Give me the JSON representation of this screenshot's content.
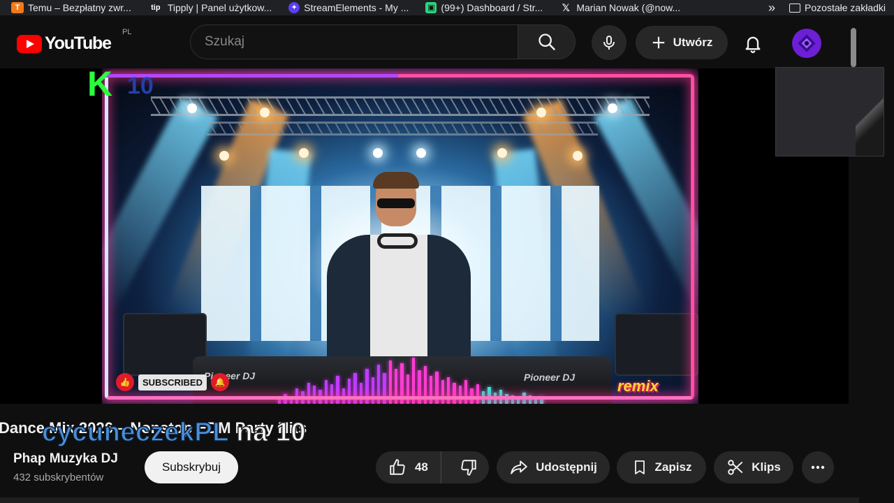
{
  "bookmarks": [
    {
      "label": "Temu – Bezpłatny zwr...",
      "icon": "temu-icon",
      "color": "#f27a1a"
    },
    {
      "label": "Tipply | Panel użytkow...",
      "icon": "tipply-icon",
      "color": "#ffffff"
    },
    {
      "label": "StreamElements - My ...",
      "icon": "streamelements-icon",
      "color": "#5a3ff5"
    },
    {
      "label": "(99+) Dashboard / Str...",
      "icon": "twitch-icon",
      "color": "#2bd67b"
    },
    {
      "label": "Marian Nowak (@now...",
      "icon": "x-icon",
      "color": "#ffffff"
    }
  ],
  "bookmarks_more": "»",
  "other_bookmarks": "Pozostałe zakładki",
  "header": {
    "logo_text": "YouTube",
    "country_code": "PL",
    "search_placeholder": "Szukaj",
    "create_label": "Utwórz"
  },
  "video": {
    "logo_k": "K",
    "logo_10": "10",
    "subscribed_label": "SUBSCRIBED",
    "deck_brand_left": "Pioneer DJ",
    "deck_brand_right": "Pioneer DJ",
    "remix_label": "remix"
  },
  "info": {
    "title": "Dance Mix 2026 – Nonstop EDM Party Hits",
    "overlay_name": "cycuneczekPL",
    "overlay_suffix": "na 10",
    "channel_name": "Phap Muzyka DJ",
    "subscribers": "432 subskrybentów",
    "subscribe_label": "Subskrybuj",
    "like_count": "48",
    "share_label": "Udostępnij",
    "save_label": "Zapisz",
    "clip_label": "Klips"
  },
  "colors": {
    "accent_red": "#ff0000",
    "background": "#0f0f0f",
    "chip": "#272727"
  }
}
